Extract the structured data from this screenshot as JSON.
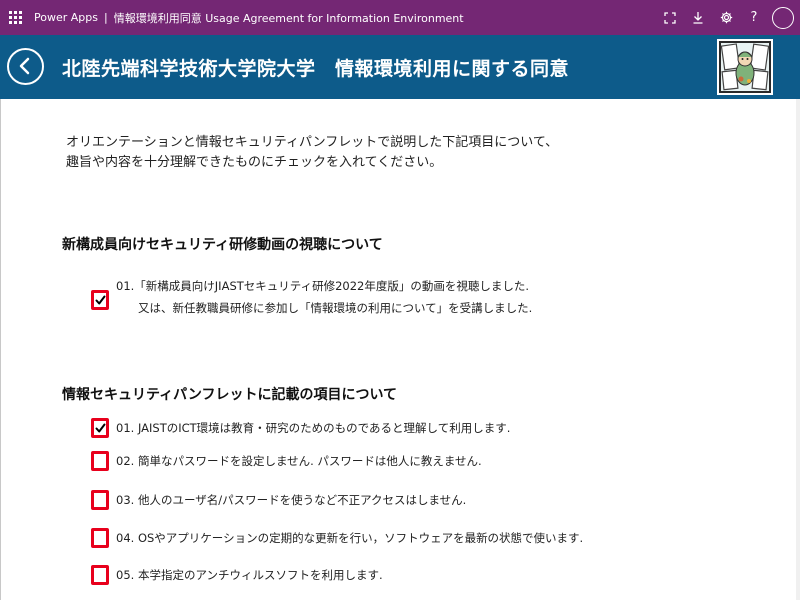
{
  "topbar": {
    "app_name": "Power Apps",
    "separator": "|",
    "app_title": "情報環境利用同意 Usage Agreement for Information Environment",
    "icons": [
      "waffle-icon",
      "fit-to-screen-icon",
      "download-icon",
      "settings-icon",
      "help-icon",
      "avatar-icon"
    ],
    "help_label": "?"
  },
  "header": {
    "title": "北陸先端科学技術大学院大学　情報環境利用に関する同意",
    "background_color": "#0d5b8a"
  },
  "intro": {
    "line1": "オリエンテーションと情報セキュリティパンフレットで説明した下記項目について、",
    "line2": "趣旨や内容を十分理解できたものにチェックを入れてください。"
  },
  "section1": {
    "title": "新構成員向けセキュリティ研修動画の視聴について",
    "items": [
      {
        "line1": "01.「新構成員向けJIASTセキュリティ研修2022年度版」の動画を視聴しました.",
        "line2": "又は、新任教職員研修に参加し「情報環境の利用について」を受講しました.",
        "checked": true
      }
    ]
  },
  "section2": {
    "title": "情報セキュリティパンフレットに記載の項目について",
    "items": [
      {
        "text": "01. JAISTのICT環境は教育・研究のためのものであると理解して利用します.",
        "checked": true
      },
      {
        "text": "02. 簡単なパスワードを設定しません. パスワードは他人に教えません.",
        "checked": false
      },
      {
        "text": "03. 他人のユーザ名/パスワードを使うなど不正アクセスはしません.",
        "checked": false
      },
      {
        "text": "04. OSやアプリケーションの定期的な更新を行い，ソフトウェアを最新の状態で使います.",
        "checked": false
      },
      {
        "text": "05. 本学指定のアンチウィルスソフトを利用します.",
        "checked": false
      }
    ]
  },
  "colors": {
    "topbar": "#742774",
    "checkbox_border": "#e8001c"
  }
}
